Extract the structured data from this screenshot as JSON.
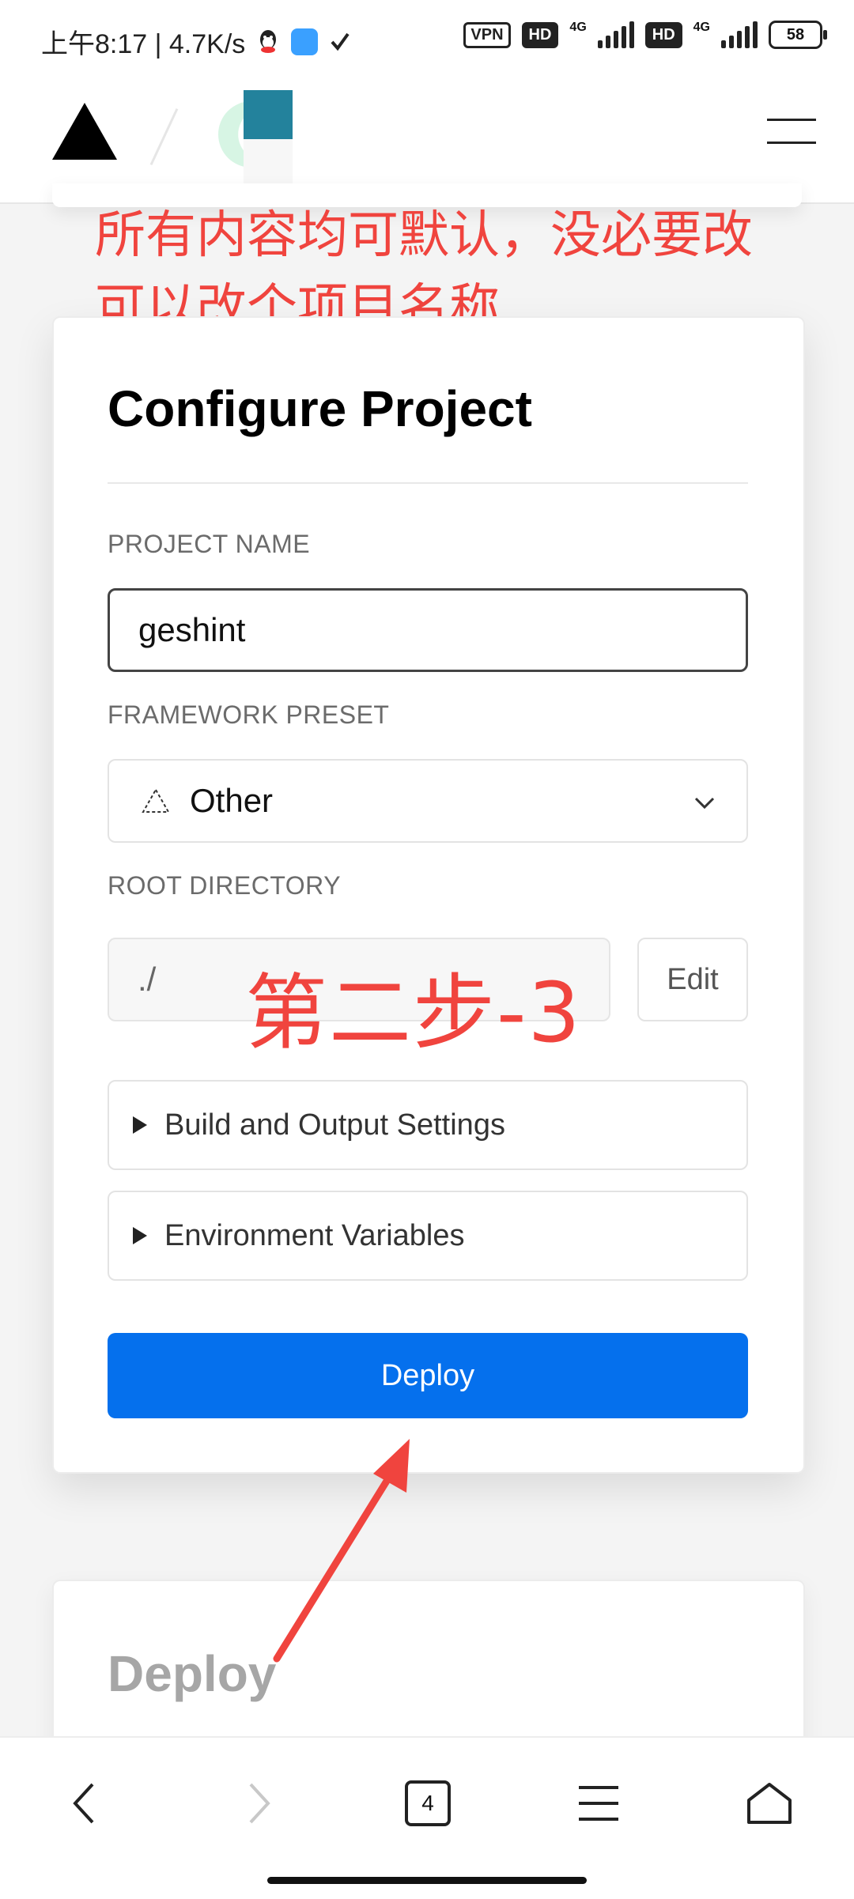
{
  "status_bar": {
    "time_speed": "上午8:17 | 4.7K/s",
    "vpn": "VPN",
    "hd1": "HD",
    "hd2": "HD",
    "net1": "4G",
    "net2": "4G",
    "battery": "58"
  },
  "annotations": {
    "top_note_line1": "所有内容均可默认，没必要改",
    "top_note_line2": "可以改个项目名称",
    "step_label": "第二步-3"
  },
  "configure": {
    "title": "Configure Project",
    "project_name_label": "PROJECT NAME",
    "project_name_value": "geshint",
    "framework_label": "FRAMEWORK PRESET",
    "framework_value": "Other",
    "root_label": "ROOT DIRECTORY",
    "root_value": "./",
    "edit_label": "Edit",
    "build_settings_label": "Build and Output Settings",
    "env_vars_label": "Environment Variables",
    "deploy_label": "Deploy"
  },
  "deploy_section": {
    "title": "Deploy"
  },
  "bottom_nav": {
    "tab_count": "4"
  },
  "colors": {
    "accent": "#0570ed",
    "annotation": "#f0443e"
  }
}
